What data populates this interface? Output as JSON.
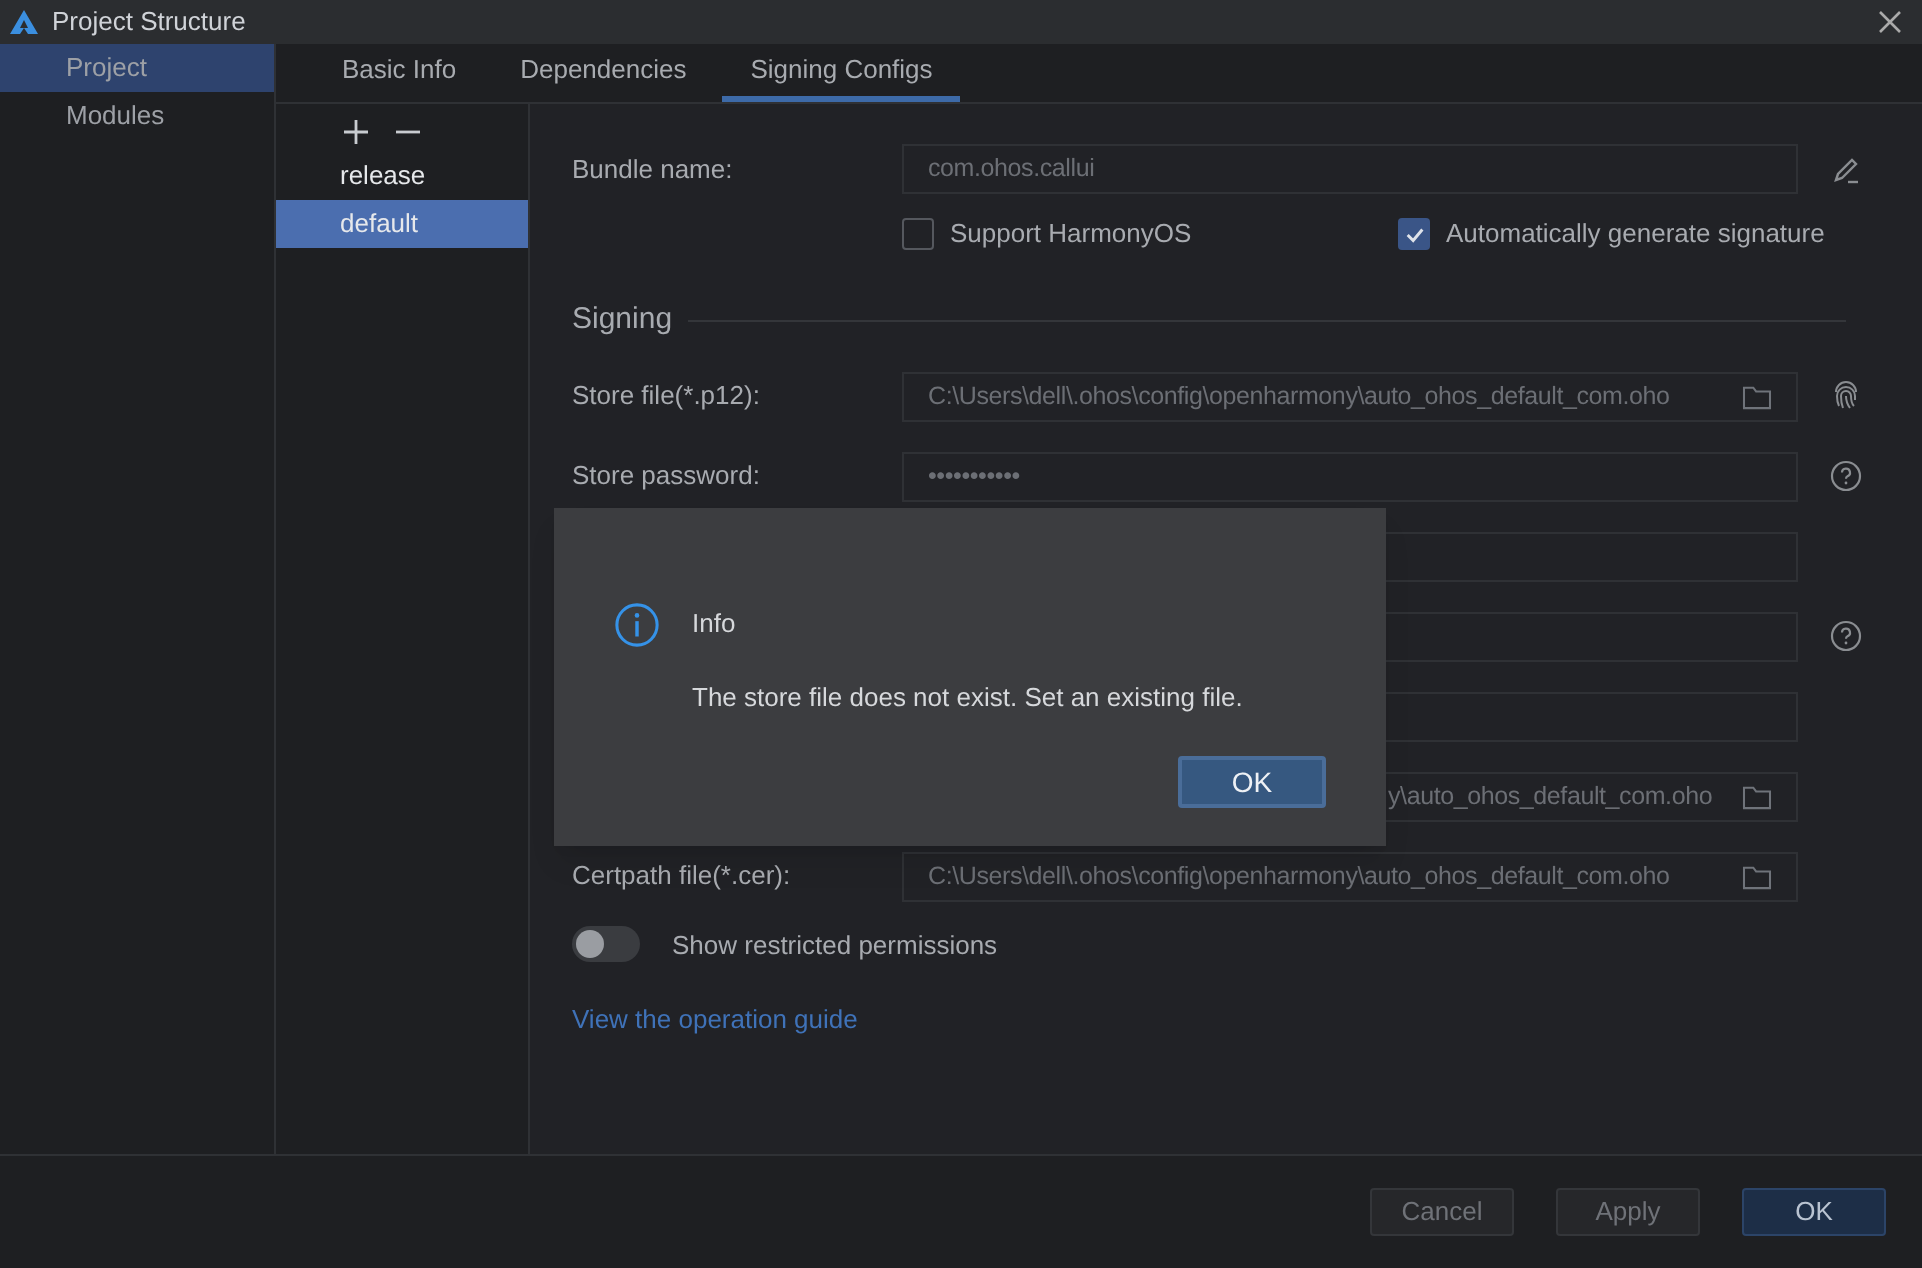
{
  "window": {
    "title": "Project Structure"
  },
  "nav": [
    {
      "label": "Project",
      "selected": true
    },
    {
      "label": "Modules",
      "selected": false
    }
  ],
  "tabs": [
    {
      "label": "Basic Info",
      "selected": false
    },
    {
      "label": "Dependencies",
      "selected": false
    },
    {
      "label": "Signing Configs",
      "selected": true
    }
  ],
  "configs": [
    {
      "label": "release",
      "selected": false
    },
    {
      "label": "default",
      "selected": true
    }
  ],
  "bundle": {
    "label": "Bundle name:",
    "value": "com.ohos.callui"
  },
  "checkboxes": [
    {
      "label": "Support HarmonyOS",
      "checked": false
    },
    {
      "label": "Automatically generate signature",
      "checked": true
    }
  ],
  "section": "Signing",
  "fields": [
    {
      "label": "Store file(*.p12):",
      "value": "C:\\Users\\dell\\.ohos\\config\\openharmony\\auto_ohos_default_com.oho",
      "kind": "file"
    },
    {
      "label": "Store password:",
      "value": "•••••••••••",
      "kind": "text"
    },
    {
      "kind": "covered"
    },
    {
      "kind": "covered"
    },
    {
      "kind": "covered"
    },
    {
      "value": "y\\auto_ohos_default_com.oho",
      "kind": "covered-file"
    },
    {
      "label": "Certpath file(*.cer):",
      "value": "C:\\Users\\dell\\.ohos\\config\\openharmony\\auto_ohos_default_com.oho",
      "kind": "file"
    }
  ],
  "toggle": {
    "label": "Show restricted permissions",
    "on": false
  },
  "link": "View the operation guide",
  "dialog": {
    "title": "Info",
    "message": "The store file does not exist. Set an existing file.",
    "button": "OK"
  },
  "footer": [
    {
      "label": "Cancel",
      "kind": "secondary"
    },
    {
      "label": "Apply",
      "kind": "secondary"
    },
    {
      "label": "OK",
      "kind": "primary"
    }
  ]
}
